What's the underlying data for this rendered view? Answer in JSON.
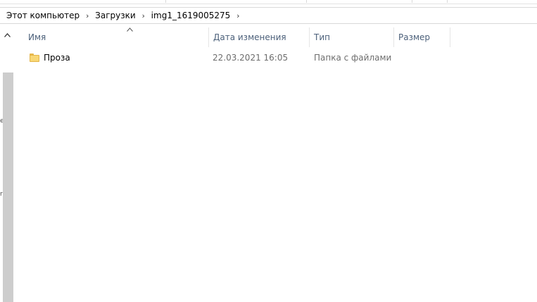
{
  "breadcrumb": {
    "items": [
      "Этот компьютер",
      "Загрузки",
      "img1_1619005275"
    ],
    "separator": "›"
  },
  "columns": {
    "name": "Имя",
    "date": "Дата изменения",
    "type": "Тип",
    "size": "Размер"
  },
  "files": [
    {
      "name": "Проза",
      "date": "22.03.2021 16:05",
      "type": "Папка с файлами",
      "size": "",
      "icon": "folder-icon"
    }
  ],
  "colors": {
    "header_text": "#4c607a",
    "secondary_text": "#6d6d6d",
    "folder": "#f8d775",
    "scrollbar": "#cdcdcd"
  }
}
